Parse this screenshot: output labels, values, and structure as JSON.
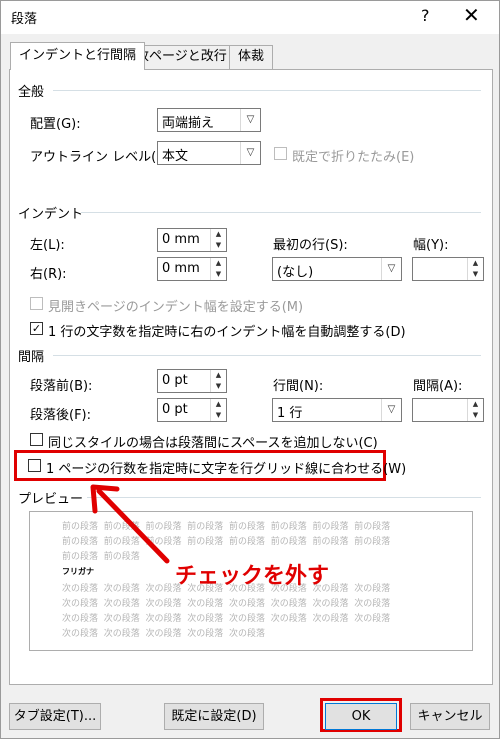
{
  "window": {
    "title": "段落",
    "help": "?",
    "close": "✕"
  },
  "tabs": [
    {
      "label": "インデントと行間隔",
      "active": true
    },
    {
      "label": "改ページと改行",
      "active": false
    },
    {
      "label": "体裁",
      "active": false
    }
  ],
  "general": {
    "title": "全般",
    "alignment_label": "配置(G):",
    "alignment_value": "両端揃え",
    "outline_label": "アウトライン レベル(O):",
    "outline_value": "本文",
    "collapsed_label": "既定で折りたたみ(E)"
  },
  "indent": {
    "title": "インデント",
    "left_label": "左(L):",
    "left_value": "0 mm",
    "right_label": "右(R):",
    "right_value": "0 mm",
    "first_line_label": "最初の行(S):",
    "first_line_value": "(なし)",
    "width_label": "幅(Y):",
    "width_value": "",
    "mirror_label": "見開きページのインデント幅を設定する(M)",
    "mirror_checked": false,
    "auto_adjust_label": "1 行の文字数を指定時に右のインデント幅を自動調整する(D)",
    "auto_adjust_checked": true
  },
  "spacing": {
    "title": "間隔",
    "before_label": "段落前(B):",
    "before_value": "0 pt",
    "after_label": "段落後(F):",
    "after_value": "0 pt",
    "line_spacing_label": "行間(N):",
    "line_spacing_value": "1 行",
    "at_label": "間隔(A):",
    "at_value": "",
    "no_space_same_style_label": "同じスタイルの場合は段落間にスペースを追加しない(C)",
    "no_space_same_style_checked": false,
    "snap_to_grid_label": "1 ページの行数を指定時に文字を行グリッド線に合わせる(W)",
    "snap_to_grid_checked": false
  },
  "preview": {
    "title": "プレビュー",
    "prev_para_text": "前の段落",
    "sample_text": "フリガナ",
    "next_para_text": "次の段落"
  },
  "annotation": {
    "text": "チェックを外す",
    "color": "#e00000"
  },
  "buttons": {
    "tabs": "タブ設定(T)...",
    "set_default": "既定に設定(D)",
    "ok": "OK",
    "cancel": "キャンセル"
  },
  "icons": {
    "dropdown": "▽",
    "spin_up": "▲",
    "spin_down": "▼",
    "check": "✓"
  }
}
